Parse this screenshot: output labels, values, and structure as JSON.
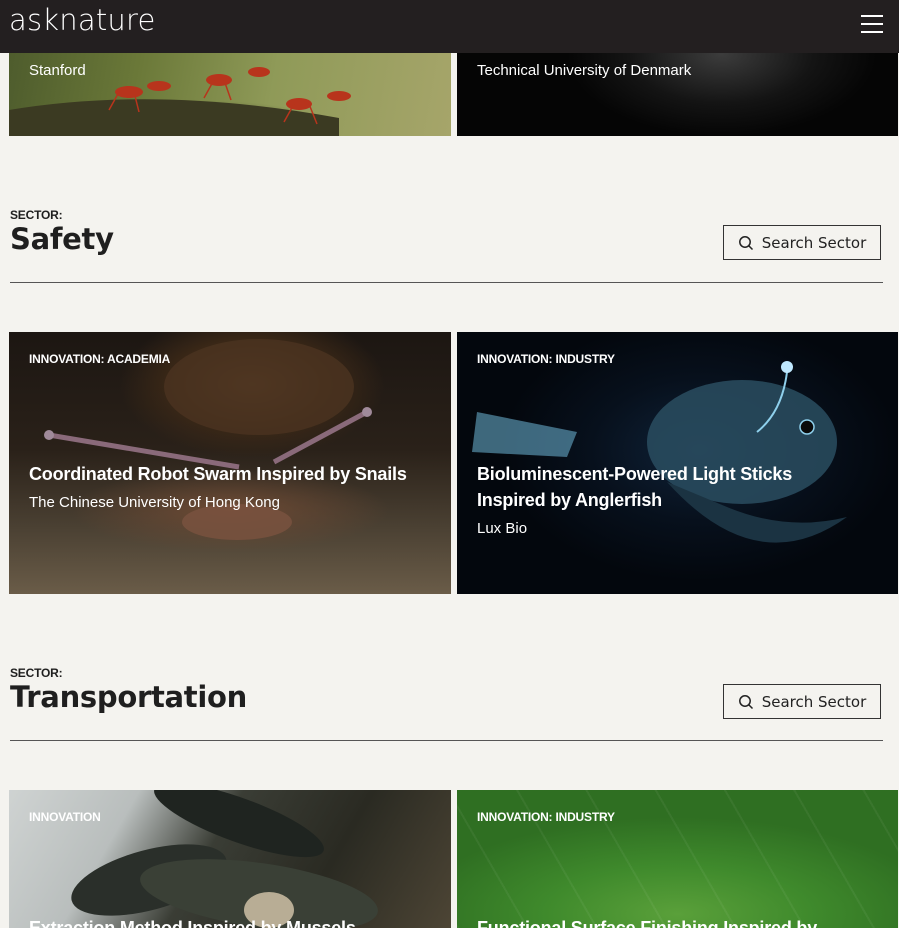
{
  "header": {
    "logo": "asknature",
    "menu_icon": "hamburger-menu-icon"
  },
  "top_cards": [
    {
      "org": "Stanford"
    },
    {
      "org": "Technical University of Denmark"
    }
  ],
  "sectors": [
    {
      "label": "SECTOR:",
      "title": "Safety",
      "search_label": "Search Sector",
      "cards": [
        {
          "tag": "INNOVATION: ACADEMIA",
          "title": "Coordinated Robot Swarm Inspired by Snails",
          "org": "The Chinese University of Hong Kong"
        },
        {
          "tag": "INNOVATION: INDUSTRY",
          "title": "Bioluminescent-Powered Light Sticks Inspired by Anglerfish",
          "org": "Lux Bio"
        }
      ]
    },
    {
      "label": "SECTOR:",
      "title": "Transportation",
      "search_label": "Search Sector",
      "cards": [
        {
          "tag": "INNOVATION",
          "title": "Extraction Method Inspired by Mussels"
        },
        {
          "tag": "INNOVATION: INDUSTRY",
          "title": "Functional Surface Finishing Inspired by..."
        }
      ]
    }
  ],
  "colors": {
    "header_bg": "#231f20",
    "page_bg": "#f4f3ef",
    "text": "#1f1f1f"
  }
}
